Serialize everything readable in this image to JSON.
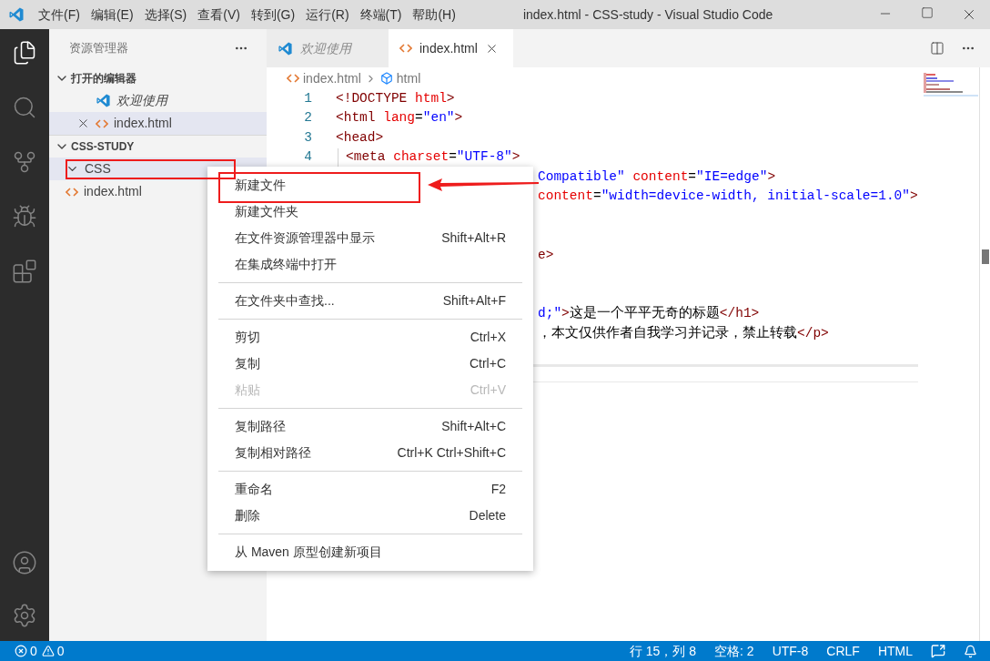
{
  "title_bar": {
    "menus": [
      "文件(F)",
      "编辑(E)",
      "选择(S)",
      "查看(V)",
      "转到(G)",
      "运行(R)",
      "终端(T)",
      "帮助(H)"
    ],
    "title": "index.html - CSS-study - Visual Studio Code"
  },
  "activity_bar": [
    {
      "kind": "explorer",
      "selected": true
    },
    {
      "kind": "search",
      "selected": false
    },
    {
      "kind": "source_control",
      "selected": false
    },
    {
      "kind": "run",
      "selected": false
    },
    {
      "kind": "extensions",
      "selected": false
    }
  ],
  "sidebar": {
    "title": "资源管理器",
    "sections": [
      {
        "title": "打开的编辑器",
        "expanded": true,
        "items": [
          {
            "label": "欢迎使用",
            "kind": "welcome",
            "selected": false,
            "italic": true
          },
          {
            "label": "index.html",
            "kind": "html",
            "selected": true,
            "italic": false
          }
        ]
      },
      {
        "title": "CSS-STUDY",
        "expanded": true,
        "items": [
          {
            "label": "CSS",
            "kind": "folder",
            "selected": true,
            "italic": false,
            "expanded": true
          },
          {
            "label": "index.html",
            "kind": "html",
            "selected": false,
            "italic": false
          }
        ]
      }
    ]
  },
  "editor": {
    "tabs": [
      {
        "label": "欢迎使用",
        "kind": "welcome",
        "selected": false,
        "italic": true
      },
      {
        "label": "index.html",
        "kind": "html",
        "selected": true,
        "italic": false
      }
    ],
    "breadcrumb": [
      "index.html",
      "html"
    ],
    "lines": [
      {
        "kind": "full",
        "number": "1",
        "tokens": [
          {
            "kind": "tag",
            "s": "<!DOCTYPE"
          },
          {
            "kind": "attr",
            "s": " html"
          },
          {
            "kind": "tag",
            "s": ">"
          }
        ]
      },
      {
        "kind": "full",
        "number": "2",
        "tokens": [
          {
            "kind": "tag",
            "s": "<html"
          },
          {
            "kind": "attr",
            "s": " lang"
          },
          {
            "kind": "plain",
            "s": "="
          },
          {
            "kind": "value",
            "s": "\"en\""
          },
          {
            "kind": "tag",
            "s": ">"
          }
        ]
      },
      {
        "kind": "full",
        "number": "3",
        "tokens": [
          {
            "kind": "tag",
            "s": "<head>"
          }
        ]
      },
      {
        "kind": "full",
        "number": "4",
        "indent": true,
        "tokens": [
          {
            "kind": "tag",
            "s": "<meta"
          },
          {
            "kind": "attr",
            "s": " charset"
          },
          {
            "kind": "plain",
            "s": "="
          },
          {
            "kind": "value",
            "s": "\"UTF-8\""
          },
          {
            "kind": "tag",
            "s": ">"
          }
        ]
      },
      {
        "kind": "clipped",
        "tokens": [
          {
            "kind": "value",
            "s": "Compatible\""
          },
          {
            "kind": "attr",
            "s": " content"
          },
          {
            "kind": "plain",
            "s": "="
          },
          {
            "kind": "value",
            "s": "\"IE=edge\""
          },
          {
            "kind": "tag",
            "s": ">"
          }
        ]
      },
      {
        "kind": "clipped",
        "tokens": [
          {
            "kind": "attr",
            "s": "content"
          },
          {
            "kind": "plain",
            "s": "="
          },
          {
            "kind": "value",
            "s": "\"width=device-width, initial-scale=1.0\""
          },
          {
            "kind": "tag",
            "s": ">"
          }
        ]
      },
      {
        "kind": "blank"
      },
      {
        "kind": "blank"
      },
      {
        "kind": "clipped",
        "tokens": [
          {
            "kind": "tag",
            "s": "e>"
          }
        ]
      },
      {
        "kind": "blank"
      },
      {
        "kind": "blank"
      },
      {
        "kind": "clipped",
        "tokens": [
          {
            "kind": "value",
            "s": "d;\""
          },
          {
            "kind": "tag",
            "s": ">"
          },
          {
            "kind": "plain",
            "s": "这是一个平平无奇的标题"
          },
          {
            "kind": "tag",
            "s": "</h1>"
          }
        ]
      },
      {
        "kind": "clipped",
        "tokens": [
          {
            "kind": "plain",
            "s": "，本文仅供作者自我学习并记录，禁止转载"
          },
          {
            "kind": "tag",
            "s": "</p>"
          }
        ]
      }
    ]
  },
  "context_menu": [
    [
      {
        "label": "新建文件",
        "disabled": false
      },
      {
        "label": "新建文件夹",
        "disabled": false
      },
      {
        "label": "在文件资源管理器中显示",
        "shortcut": "Shift+Alt+R",
        "disabled": false
      },
      {
        "label": "在集成终端中打开",
        "disabled": false
      }
    ],
    [
      {
        "label": "在文件夹中查找...",
        "shortcut": "Shift+Alt+F",
        "disabled": false
      }
    ],
    [
      {
        "label": "剪切",
        "shortcut": "Ctrl+X",
        "disabled": false
      },
      {
        "label": "复制",
        "shortcut": "Ctrl+C",
        "disabled": false
      },
      {
        "label": "粘贴",
        "shortcut": "Ctrl+V",
        "disabled": true
      }
    ],
    [
      {
        "label": "复制路径",
        "shortcut": "Shift+Alt+C",
        "disabled": false
      },
      {
        "label": "复制相对路径",
        "shortcut": "Ctrl+K Ctrl+Shift+C",
        "disabled": false
      }
    ],
    [
      {
        "label": "重命名",
        "shortcut": "F2",
        "disabled": false
      },
      {
        "label": "删除",
        "shortcut": "Delete",
        "disabled": false
      }
    ],
    [
      {
        "label": "从 Maven 原型创建新项目",
        "disabled": false
      }
    ]
  ],
  "status_bar": {
    "errors": "0",
    "warnings": "0",
    "items": [
      "行 15，列 8",
      "空格: 2",
      "UTF-8",
      "CRLF",
      "HTML"
    ]
  }
}
